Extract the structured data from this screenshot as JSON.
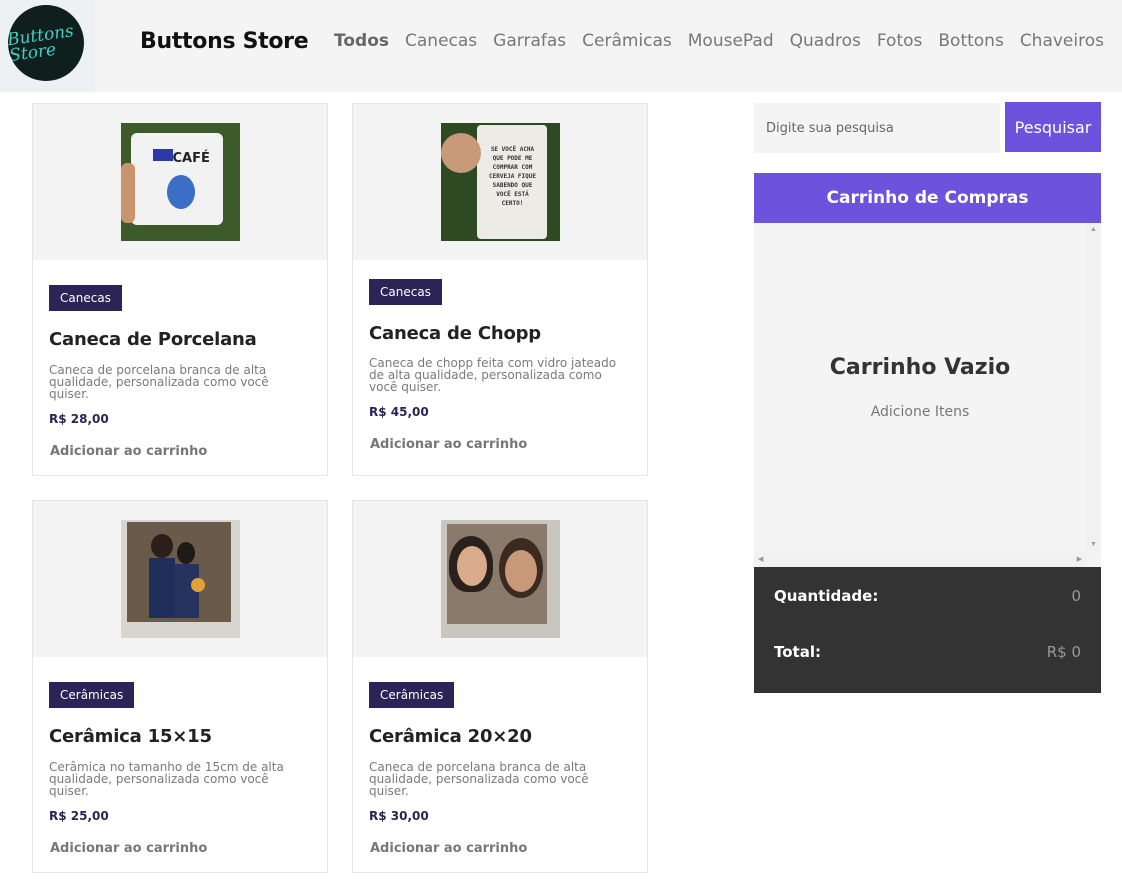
{
  "header": {
    "logo_text": "Buttons Store",
    "brand": "Buttons Store",
    "nav": [
      "Todos",
      "Canecas",
      "Garrafas",
      "Cerâmicas",
      "MousePad",
      "Quadros",
      "Fotos",
      "Bottons",
      "Chaveiros"
    ]
  },
  "products": [
    {
      "tag": "Canecas",
      "title": "Caneca de Porcelana",
      "desc": "Caneca de porcelana branca de alta qualidade, personalizada como você quiser.",
      "price": "R$ 28,00",
      "add": "Adicionar ao carrinho",
      "image_label": "CAFÉ"
    },
    {
      "tag": "Canecas",
      "title": "Caneca de Chopp",
      "desc": "Caneca de chopp feita com vidro jateado de alta qualidade, personalizada como você quiser.",
      "price": "R$ 45,00",
      "add": "Adicionar ao carrinho",
      "image_label": "SE VOCÊ ACHA QUE PODE ME COMPRAR COM CERVEJA FIQUE SABENDO QUE VOCÊ ESTÁ CERTO!"
    },
    {
      "tag": "Cerâmicas",
      "title": "Cerâmica 15×15",
      "desc": "Cerâmica no tamanho de 15cm de alta qualidade, personalizada como você quiser.",
      "price": "R$ 25,00",
      "add": "Adicionar ao carrinho"
    },
    {
      "tag": "Cerâmicas",
      "title": "Cerâmica 20×20",
      "desc": "Caneca de porcelana branca de alta qualidade, personalizada como você quiser.",
      "price": "R$ 30,00",
      "add": "Adicionar ao carrinho"
    }
  ],
  "search": {
    "placeholder": "Digite sua pesquisa",
    "button": "Pesquisar"
  },
  "cart": {
    "title": "Carrinho de Compras",
    "empty_title": "Carrinho Vazio",
    "empty_sub": "Adicione Itens",
    "quantity_label": "Quantidade:",
    "quantity_value": "0",
    "total_label": "Total:",
    "total_value": "R$ 0"
  },
  "colors": {
    "accent": "#6c53de",
    "tag": "#2c2356",
    "footer": "#333333"
  }
}
